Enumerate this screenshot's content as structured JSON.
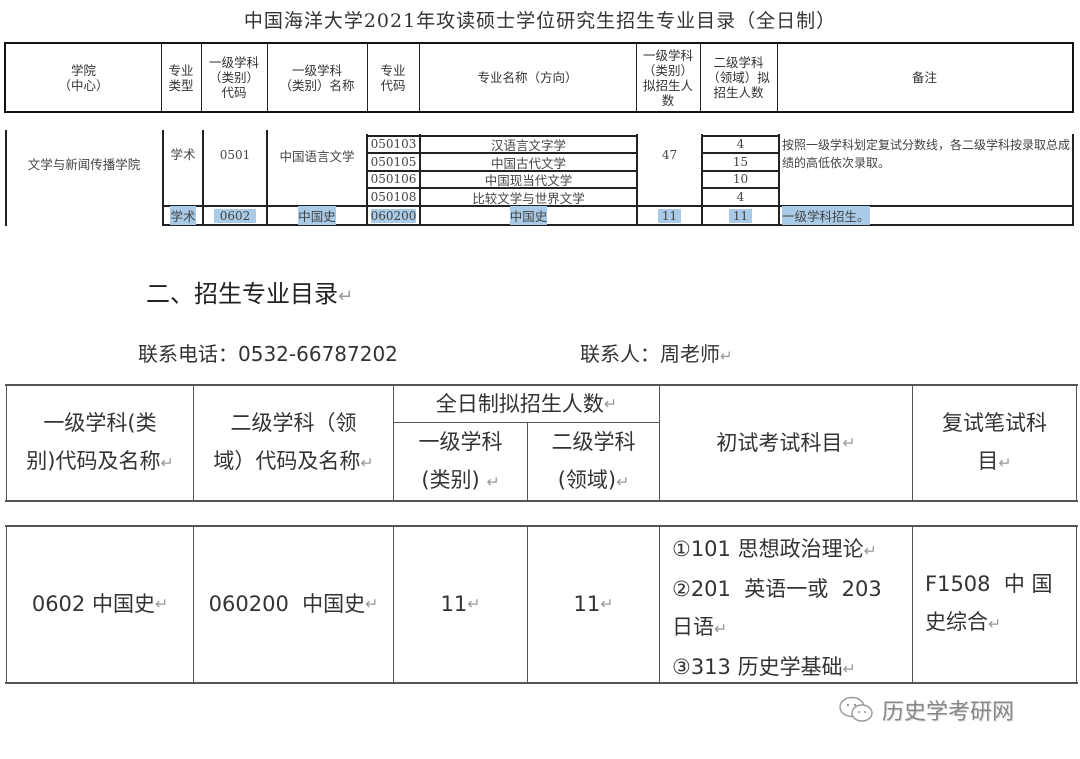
{
  "title": "中国海洋大学2021年攻读硕士学位研究生招生专业目录（全日制）",
  "catalog_table": {
    "headers": [
      "学院\n（中心）",
      "专业\n类型",
      "一级学科\n（类别）\n代码",
      "一级学科\n（类别）名称",
      "专业\n代码",
      "专业名称（方向）",
      "一级学科\n（类别）\n拟招生人\n数",
      "二级学科\n（领域）拟\n招生人数",
      "备注"
    ],
    "college": "文学与新闻传播学院",
    "groups": [
      {
        "type": "学术",
        "first_code": "0501",
        "first_name": "中国语言文学",
        "first_quota": "47",
        "note": "按照一级学科划定复试分数线，各二级学科按录取总成绩的高低依次录取。",
        "majors": [
          {
            "code": "050103",
            "name": "汉语言文字学",
            "quota": "4"
          },
          {
            "code": "050105",
            "name": "中国古代文学",
            "quota": "15"
          },
          {
            "code": "050106",
            "name": "中国现当代文学",
            "quota": "10"
          },
          {
            "code": "050108",
            "name": "比较文学与世界文学",
            "quota": "4"
          }
        ]
      },
      {
        "type": "学术",
        "first_code": "0602",
        "first_name": "中国史",
        "first_quota": "11",
        "note": "一级学科招生。",
        "highlighted": true,
        "majors": [
          {
            "code": "060200",
            "name": "中国史",
            "quota": "11"
          }
        ]
      }
    ]
  },
  "section_title": "二、招生专业目录",
  "contact": {
    "phone": "联系电话：0532-66787202",
    "person": "联系人：周老师"
  },
  "exam_table": {
    "headers": {
      "col1": "一级学科(类别)代码及名称",
      "col1_lines": [
        "一级学科(类",
        "别)代码及名称"
      ],
      "col2_lines": [
        "二级学科（领",
        "域）代码及名称"
      ],
      "group": "全日制拟招生人数",
      "sub1_lines": [
        "一级学科",
        "(类别)"
      ],
      "sub2_lines": [
        "二级学科",
        "(领域)"
      ],
      "col5": "初试考试科目",
      "col6_lines": [
        "复试笔试科",
        "目"
      ]
    },
    "row": {
      "first": "0602 中国史",
      "second": "060200  中国史",
      "quota_first": "11",
      "quota_second": "11",
      "exams": [
        "①101 思想政治理论",
        "②201  英语一或  203",
        "日语",
        "③313 历史学基础"
      ],
      "retest_lines": [
        "F1508  中 国",
        "史综合"
      ]
    }
  },
  "watermark": {
    "icon": "wechat-icon",
    "text": "历史学考研网"
  },
  "return_mark": "↵"
}
